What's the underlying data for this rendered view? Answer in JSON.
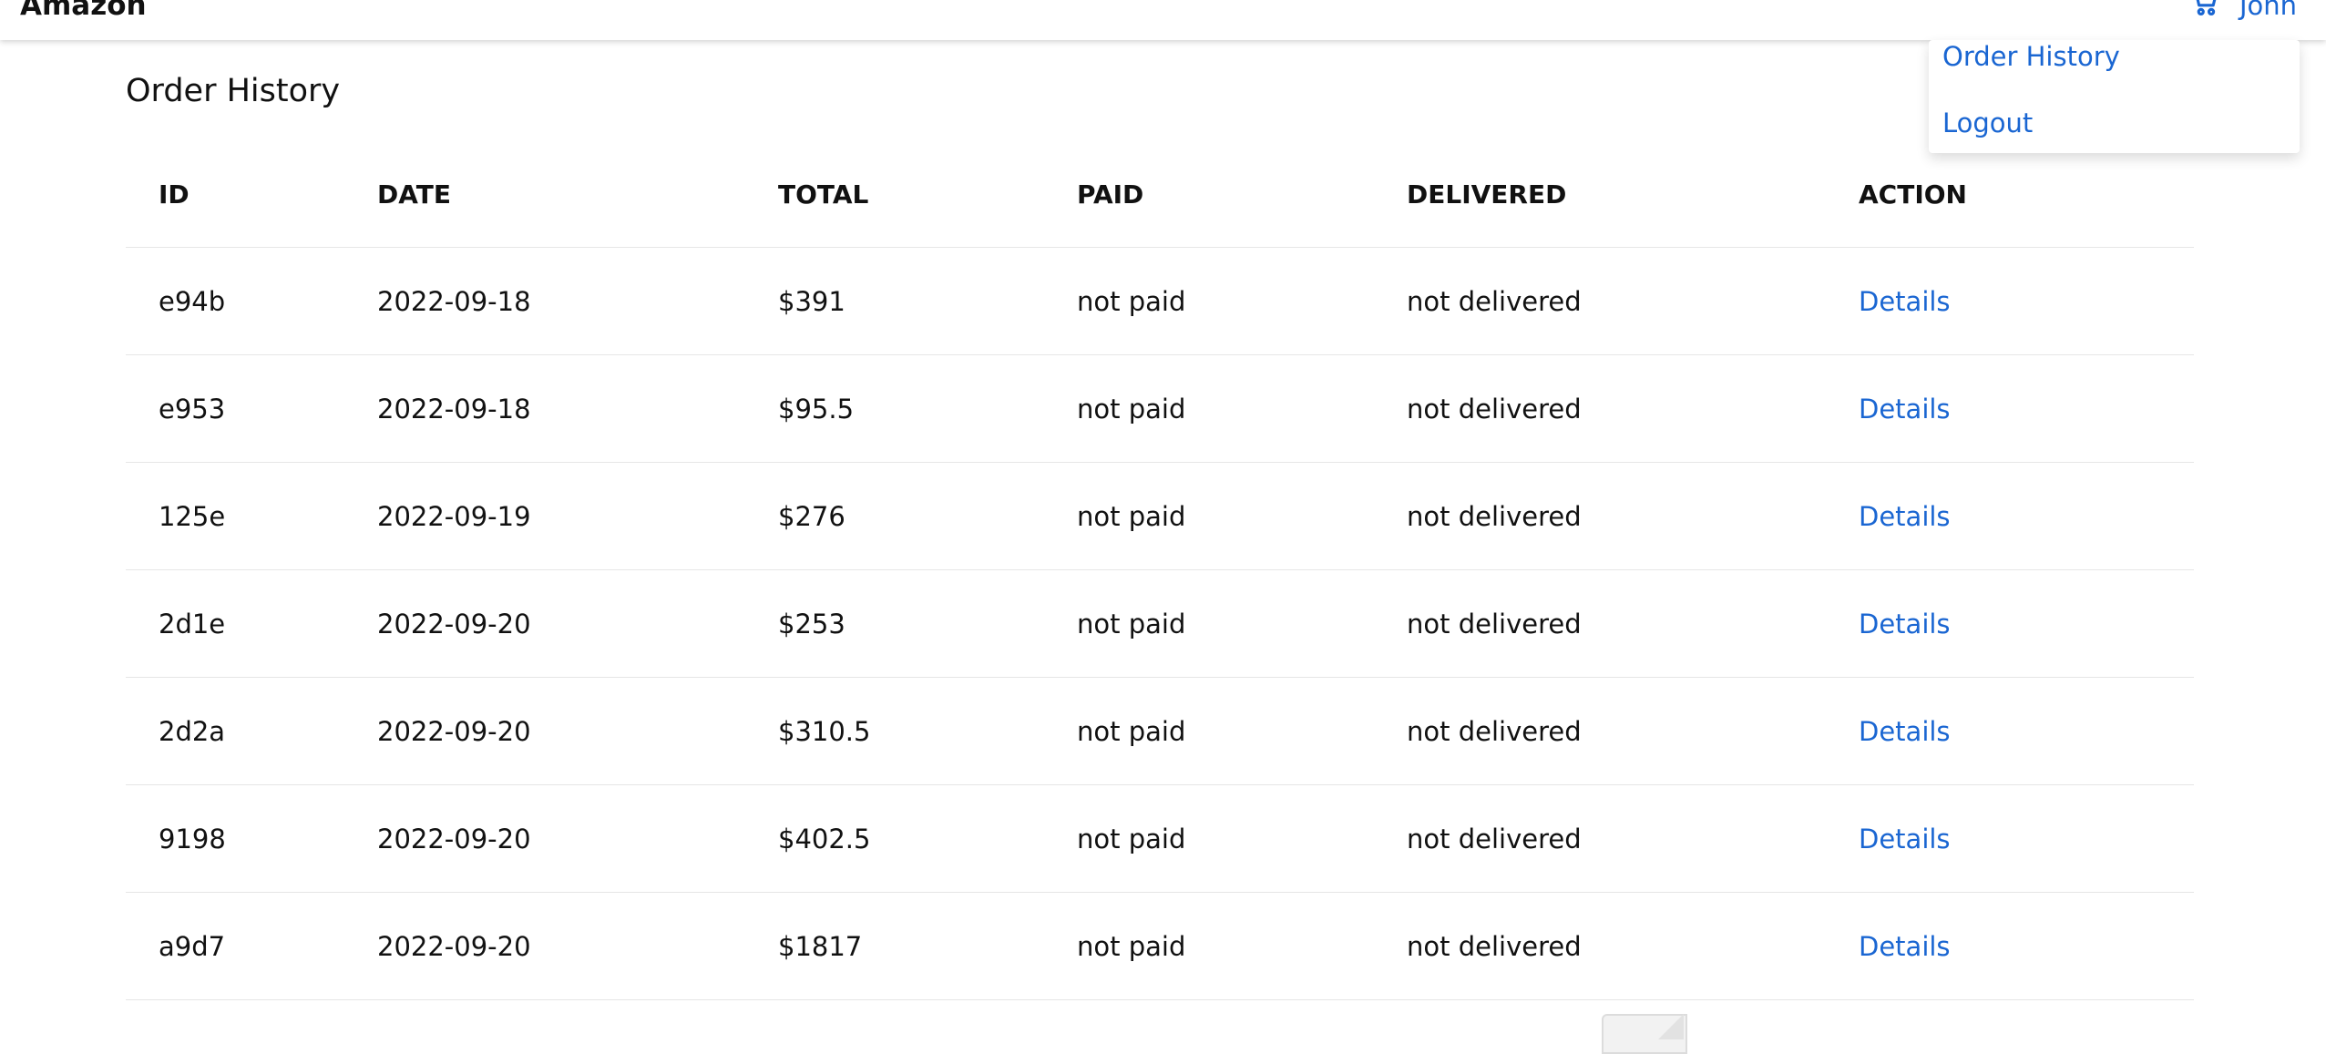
{
  "navbar": {
    "brand": "Amazon",
    "user_name": "John",
    "cart_icon": "cart-icon"
  },
  "dropdown": {
    "items": [
      {
        "label": "Order History"
      },
      {
        "label": "Logout"
      }
    ]
  },
  "colors": {
    "link": "#1a66d2",
    "text": "#111111",
    "divider": "#e6e6e6"
  },
  "page": {
    "title": "Order History"
  },
  "table": {
    "headers": [
      "ID",
      "DATE",
      "TOTAL",
      "PAID",
      "DELIVERED",
      "ACTION"
    ],
    "rows": [
      {
        "id": "e94b",
        "date": "2022-09-18",
        "total": "$391",
        "paid": "not paid",
        "delivered": "not delivered",
        "action": "Details"
      },
      {
        "id": "e953",
        "date": "2022-09-18",
        "total": "$95.5",
        "paid": "not paid",
        "delivered": "not delivered",
        "action": "Details"
      },
      {
        "id": "125e",
        "date": "2022-09-19",
        "total": "$276",
        "paid": "not paid",
        "delivered": "not delivered",
        "action": "Details"
      },
      {
        "id": "2d1e",
        "date": "2022-09-20",
        "total": "$253",
        "paid": "not paid",
        "delivered": "not delivered",
        "action": "Details"
      },
      {
        "id": "2d2a",
        "date": "2022-09-20",
        "total": "$310.5",
        "paid": "not paid",
        "delivered": "not delivered",
        "action": "Details"
      },
      {
        "id": "9198",
        "date": "2022-09-20",
        "total": "$402.5",
        "paid": "not paid",
        "delivered": "not delivered",
        "action": "Details"
      },
      {
        "id": "a9d7",
        "date": "2022-09-20",
        "total": "$1817",
        "paid": "not paid",
        "delivered": "not delivered",
        "action": "Details"
      }
    ]
  }
}
